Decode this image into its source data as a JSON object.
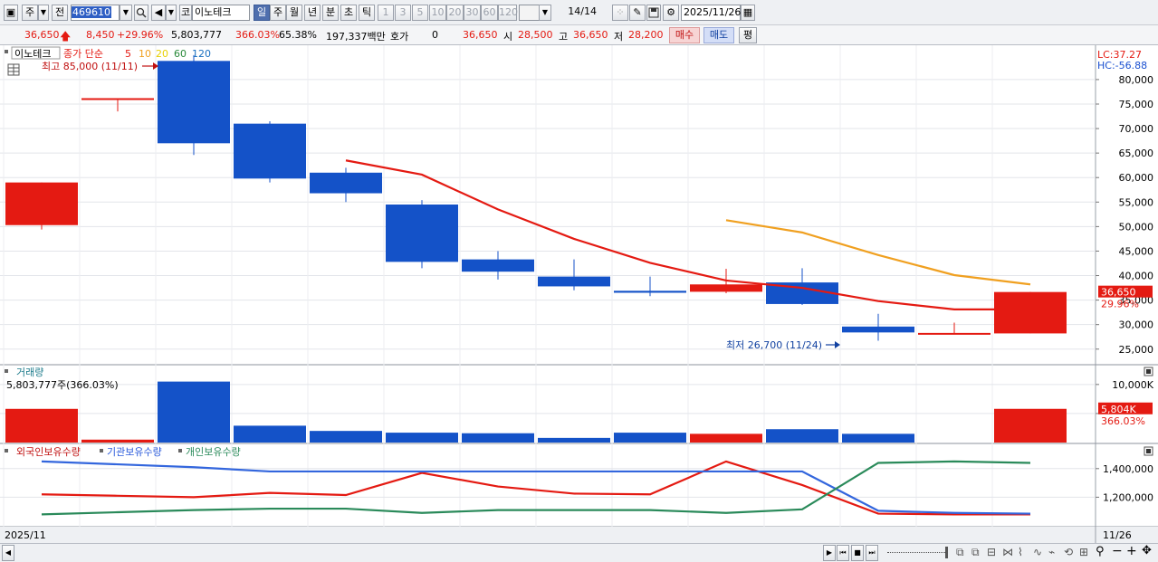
{
  "toolbar": {
    "market": "주",
    "prev_label": "전",
    "code": "469610",
    "exchange_badge": "코",
    "stock_name": "이노테크",
    "periods": [
      "일",
      "주",
      "월",
      "년",
      "분",
      "초",
      "틱"
    ],
    "active_period": "일",
    "intervals": [
      "1",
      "3",
      "5",
      "10",
      "20",
      "30",
      "60",
      "120"
    ],
    "page": "14/14",
    "date": "2025/11/26"
  },
  "quote": {
    "price": "36,650",
    "change": "8,450",
    "change_pct": "+29.96%",
    "volume": "5,803,777",
    "volume_ratio": "366.03%",
    "turnover": "65.38%",
    "amount": "197,337백만",
    "hoga_label": "호가",
    "hoga_value": "0",
    "hoga_price": "36,650",
    "open_label": "시",
    "open": "28,500",
    "high_label": "고",
    "high": "36,650",
    "low_label": "저",
    "low": "28,200",
    "buy_label": "매수",
    "sell_label": "매도",
    "eval_label": "평"
  },
  "price_panel": {
    "name": "이노테크",
    "ma_title": "종가 단순",
    "ma_periods": [
      "5",
      "10",
      "20",
      "60",
      "120"
    ],
    "ma_colors": {
      "5": "#e41a12",
      "10": "#f0a020",
      "20": "#e8d000",
      "60": "#2a8a3a",
      "120": "#1a70c0"
    },
    "high_note": "최고 85,000 (11/11)",
    "low_note": "최저 26,700 (11/24)",
    "lc": "LC:37.27",
    "hc": "HC:-56.88",
    "price_tag": "36,650",
    "pct_tag": "29.96%"
  },
  "volume_panel": {
    "title": "거래량",
    "value_text": "5,803,777주(366.03%)",
    "tag": "5,804K",
    "pct_tag": "366.03%"
  },
  "holding_panel": {
    "legend": [
      "외국인보유수량",
      "기관보유수량",
      "개인보유수량"
    ]
  },
  "footer": {
    "left_date": "2025/11",
    "right_date": "11/26"
  },
  "chart_data": {
    "type": "candlestick",
    "price_ticks": [
      25000,
      30000,
      35000,
      40000,
      45000,
      50000,
      55000,
      60000,
      65000,
      70000,
      75000,
      80000
    ],
    "price_tick_labels": [
      "25,000",
      "30,000",
      "35,000",
      "40,000",
      "45,000",
      "50,000",
      "55,000",
      "60,000",
      "65,000",
      "70,000",
      "75,000",
      "80,000"
    ],
    "price_range": [
      22000,
      87000
    ],
    "candles": [
      {
        "o": 50300,
        "h": 59000,
        "l": 49400,
        "c": 59000,
        "dir": "up"
      },
      {
        "o": 76200,
        "h": 76200,
        "l": 73500,
        "c": 76200,
        "dir": "up"
      },
      {
        "o": 83800,
        "h": 85000,
        "l": 64600,
        "c": 67000,
        "dir": "down"
      },
      {
        "o": 71000,
        "h": 71500,
        "l": 59000,
        "c": 59800,
        "dir": "down"
      },
      {
        "o": 61000,
        "h": 62000,
        "l": 55000,
        "c": 56800,
        "dir": "down"
      },
      {
        "o": 54500,
        "h": 55400,
        "l": 41500,
        "c": 42800,
        "dir": "down"
      },
      {
        "o": 43300,
        "h": 45000,
        "l": 39200,
        "c": 40800,
        "dir": "down"
      },
      {
        "o": 39800,
        "h": 43300,
        "l": 37000,
        "c": 37800,
        "dir": "down"
      },
      {
        "o": 36900,
        "h": 39800,
        "l": 35800,
        "c": 36500,
        "dir": "down"
      },
      {
        "o": 36700,
        "h": 41400,
        "l": 36400,
        "c": 38200,
        "dir": "up"
      },
      {
        "o": 38600,
        "h": 41500,
        "l": 34000,
        "c": 34200,
        "dir": "down"
      },
      {
        "o": 29600,
        "h": 32200,
        "l": 26700,
        "c": 28400,
        "dir": "down"
      },
      {
        "o": 28000,
        "h": 30400,
        "l": 28000,
        "c": 28300,
        "dir": "up"
      },
      {
        "o": 28200,
        "h": 36650,
        "l": 28200,
        "c": 36650,
        "dir": "up"
      }
    ],
    "ma5": [
      null,
      null,
      null,
      null,
      63500,
      60600,
      53500,
      47500,
      42600,
      39000,
      37500,
      34800,
      33100,
      33100
    ],
    "ma10": [
      null,
      null,
      null,
      null,
      null,
      null,
      null,
      null,
      null,
      51300,
      48800,
      44200,
      40100,
      38200
    ],
    "volume_ticks": [
      5000,
      10000
    ],
    "volume_tick_labels": [
      "",
      "10,000K"
    ],
    "volume_range": [
      0,
      12000
    ],
    "volumes": [
      5800,
      500,
      10500,
      2900,
      2000,
      1700,
      1600,
      800,
      1700,
      1500,
      2300,
      1500,
      5804
    ],
    "holding_ticks": [
      1200000,
      1400000
    ],
    "holding_tick_labels": [
      "1,200,000",
      "1,400,000"
    ],
    "holding_range": [
      1000000,
      1500000
    ],
    "holding_series": [
      {
        "name": "외국인보유수량",
        "color": "#e41a12",
        "values": [
          1220000,
          1210000,
          1200000,
          1230000,
          1215000,
          1370000,
          1275000,
          1225000,
          1220000,
          1450000,
          1285000,
          1085000,
          1080000,
          1080000
        ]
      },
      {
        "name": "기관보유수량",
        "color": "#3366dd",
        "values": [
          1450000,
          1430000,
          1410000,
          1380000,
          1380000,
          1380000,
          1380000,
          1380000,
          1380000,
          1380000,
          1380000,
          1105000,
          1090000,
          1085000
        ]
      },
      {
        "name": "개인보유수량",
        "color": "#2a8a5a",
        "values": [
          1080000,
          1095000,
          1110000,
          1120000,
          1120000,
          1090000,
          1110000,
          1110000,
          1110000,
          1090000,
          1115000,
          1440000,
          1450000,
          1440000
        ]
      }
    ]
  }
}
